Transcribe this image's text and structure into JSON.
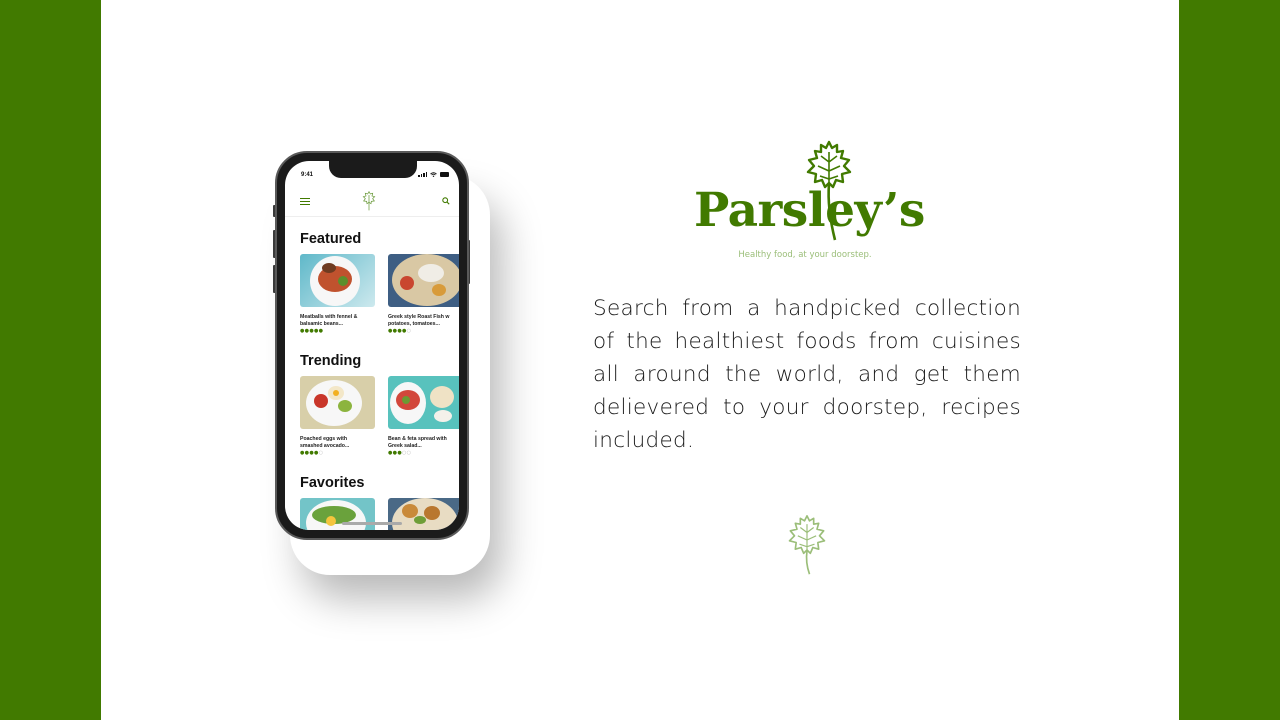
{
  "brand": {
    "name": "Parsley’s",
    "tagline": "Healthy food, at your doorstep.",
    "color": "#417a00",
    "icon": "parsley-leaf-icon"
  },
  "description": "Search from a handpicked collection of the healthiest foods from cuisines all around the world, and get them delievered to your doorstep, recipes included.",
  "phone": {
    "status_time": "9:41",
    "appbar": {
      "menu_icon": "hamburger-menu-icon",
      "logo_icon": "parsley-leaf-icon",
      "search_icon": "search-icon"
    },
    "sections": [
      {
        "title": "Featured",
        "cards": [
          {
            "caption": "Meatballs with fennel &\nbalsamic beans...",
            "rating": 5
          },
          {
            "caption": "Greek style Roast Fish w\npotatoes, tomatoes...",
            "rating": 4
          }
        ]
      },
      {
        "title": "Trending",
        "cards": [
          {
            "caption": "Poached eggs with\nsmashed avocado...",
            "rating": 4
          },
          {
            "caption": "Bean & feta spread with\nGreek salad...",
            "rating": 3
          }
        ]
      },
      {
        "title": "Favorites",
        "cards": [
          {
            "caption": "",
            "rating": 0
          },
          {
            "caption": "",
            "rating": 0
          }
        ]
      }
    ]
  }
}
